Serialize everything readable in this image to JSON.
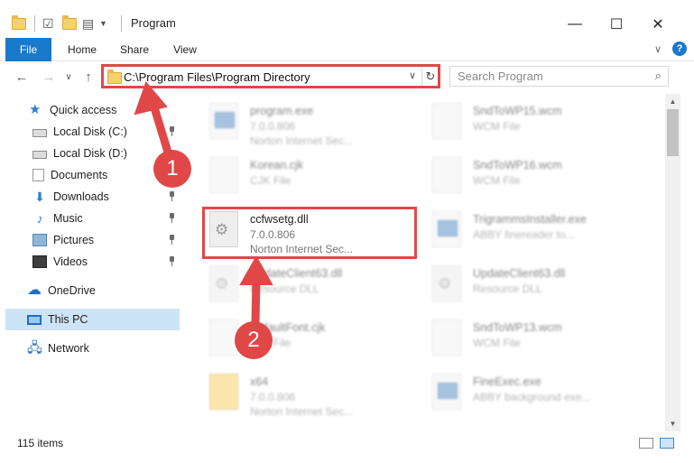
{
  "window": {
    "title": "Program",
    "controls": {
      "minimize": "—",
      "maximize": "☐",
      "close": "✕"
    }
  },
  "ribbon": {
    "tabs": [
      "File",
      "Home",
      "Share",
      "View"
    ],
    "expand": "∨",
    "help": "?"
  },
  "nav": {
    "back": "←",
    "forward": "→",
    "recent": "∨",
    "up": "↑"
  },
  "address": {
    "path": "C:\\Program Files\\Program Directory",
    "dropdown": "∨",
    "refresh": "↻"
  },
  "search": {
    "placeholder": "Search Program",
    "icon": "search-icon"
  },
  "sidebar": {
    "items": [
      {
        "label": "Quick access",
        "icon": "star-icon",
        "pinned": false
      },
      {
        "label": "Local Disk (C:)",
        "icon": "drive-icon",
        "pinned": true
      },
      {
        "label": "Local Disk (D:)",
        "icon": "drive-icon",
        "pinned": false
      },
      {
        "label": "Documents",
        "icon": "documents-icon",
        "pinned": false
      },
      {
        "label": "Downloads",
        "icon": "downloads-icon",
        "pinned": true
      },
      {
        "label": "Music",
        "icon": "music-icon",
        "pinned": true
      },
      {
        "label": "Pictures",
        "icon": "pictures-icon",
        "pinned": true
      },
      {
        "label": "Videos",
        "icon": "videos-icon",
        "pinned": true
      },
      {
        "label": "OneDrive",
        "icon": "onedrive-icon",
        "pinned": false
      },
      {
        "label": "This PC",
        "icon": "pc-icon",
        "pinned": false,
        "selected": true
      },
      {
        "label": "Network",
        "icon": "network-icon",
        "pinned": false
      }
    ]
  },
  "files": {
    "left": [
      {
        "name": "program.exe",
        "line2": "7.0.0.806",
        "line3": "Norton Internet Sec..."
      },
      {
        "name": "Korean.cjk",
        "line2": "CJK File",
        "line3": ""
      },
      {
        "name": "ccfwsetg.dll",
        "line2": "7.0.0.806",
        "line3": "Norton Internet Sec..."
      },
      {
        "name": "UpdateClient63.dll",
        "line2": "Resource DLL",
        "line3": ""
      },
      {
        "name": "DefaultFont.cjk",
        "line2": "CJK File",
        "line3": ""
      },
      {
        "name": "x64",
        "line2": "7.0.0.806",
        "line3": "Norton Internet Sec..."
      }
    ],
    "right": [
      {
        "name": "SndToWP15.wcm",
        "line2": "WCM File",
        "line3": ""
      },
      {
        "name": "SndToWP16.wcm",
        "line2": "WCM File",
        "line3": ""
      },
      {
        "name": "TrigrammsInstaller.exe",
        "line2": "ABBY finereader to...",
        "line3": ""
      },
      {
        "name": "UpdateClient63.dll",
        "line2": "Resource DLL",
        "line3": ""
      },
      {
        "name": "SndToWP13.wcm",
        "line2": "WCM File",
        "line3": ""
      },
      {
        "name": "FineExec.exe",
        "line2": "ABBY background exe...",
        "line3": ""
      }
    ]
  },
  "status": {
    "count": "115 items"
  },
  "annotations": {
    "step1": "1",
    "step2": "2"
  },
  "colors": {
    "accent": "#1979ca",
    "highlight": "#e04848",
    "selection": "#cce4f7"
  }
}
